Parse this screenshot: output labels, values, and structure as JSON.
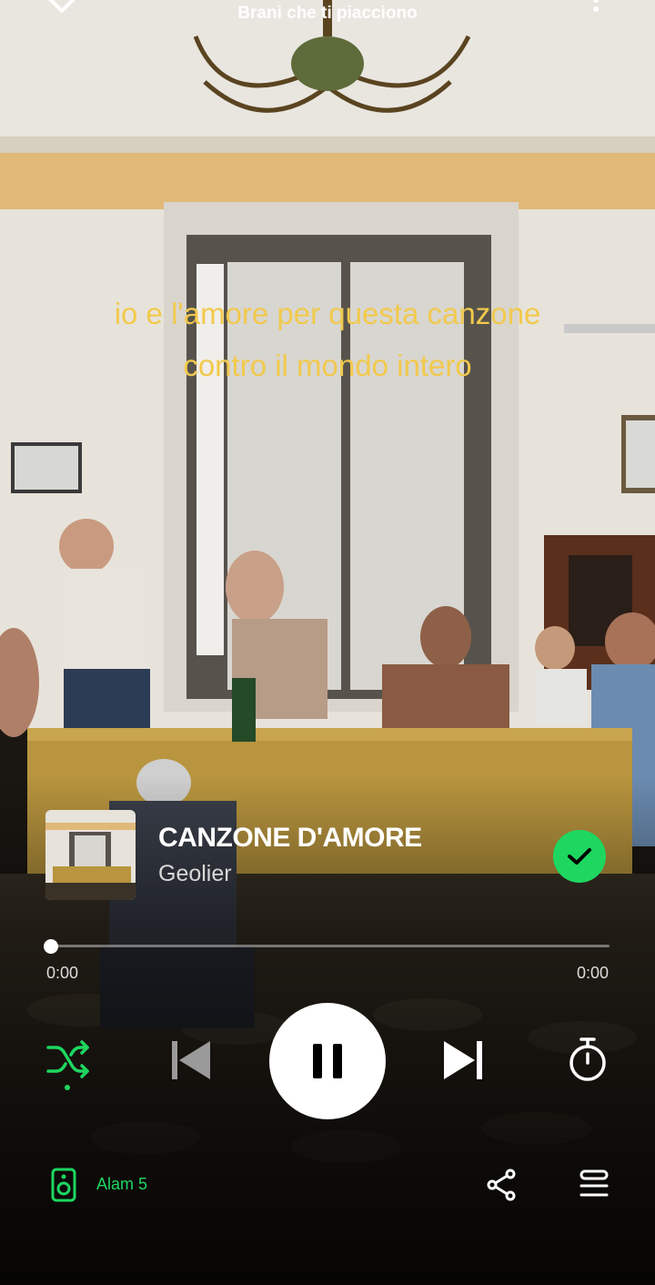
{
  "header": {
    "playlist_title": "Brani che ti piacciono"
  },
  "lyrics": {
    "lines": [
      "io e l'amore per questa canzone",
      "contro il mondo intero"
    ]
  },
  "track": {
    "title": "CANZONE D'AMORE",
    "artist": "Geolier",
    "liked": true
  },
  "playback": {
    "elapsed": "0:00",
    "remaining": "0:00",
    "progress_fraction": 0.0,
    "state": "playing"
  },
  "device": {
    "name": "Alam 5"
  },
  "colors": {
    "accent": "#1ed760",
    "lyrics": "#f2c94c"
  },
  "icons": [
    "chevron-down-icon",
    "more-options-icon",
    "check-icon",
    "shuffle-icon",
    "previous-icon",
    "pause-icon",
    "next-icon",
    "sleep-timer-icon",
    "speaker-icon",
    "share-icon",
    "queue-icon"
  ]
}
